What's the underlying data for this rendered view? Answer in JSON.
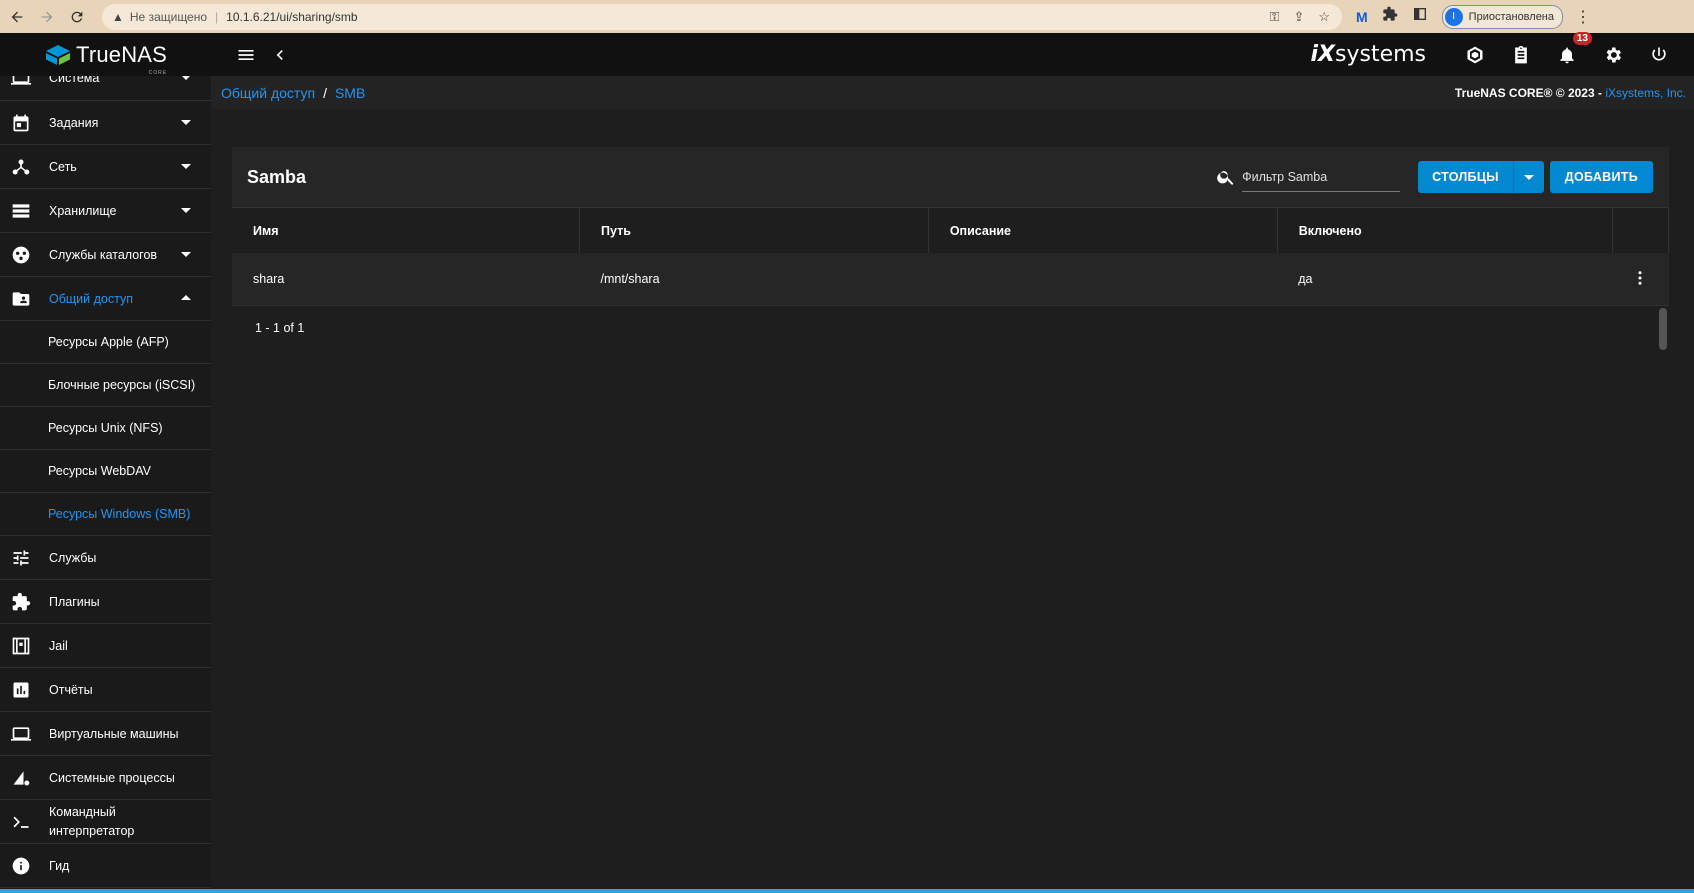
{
  "browser": {
    "security_label": "Не защищено",
    "url": "10.1.6.21/ui/sharing/smb",
    "profile_initial": "I",
    "profile_status": "Приостановлена"
  },
  "topbar": {
    "brand": "TrueNAS",
    "brand_sub": "CORE",
    "vendor_logo": "systems",
    "vendor_logo_prefix": "iX",
    "alerts_count": "13"
  },
  "breadcrumb": {
    "parent": "Общий доступ",
    "separator": "/",
    "current": "SMB"
  },
  "copyright": {
    "text": "TrueNAS CORE® © 2023 - ",
    "link": "iXsystems, Inc."
  },
  "sidebar": {
    "items": [
      {
        "label": "Система",
        "icon": "laptop-icon"
      },
      {
        "label": "Задания",
        "icon": "calendar-icon"
      },
      {
        "label": "Сеть",
        "icon": "network-icon"
      },
      {
        "label": "Хранилище",
        "icon": "storage-icon"
      },
      {
        "label": "Службы каталогов",
        "icon": "directory-icon"
      },
      {
        "label": "Общий доступ",
        "icon": "folder-shared-icon"
      }
    ],
    "sub_items": [
      {
        "label": "Ресурсы Apple (AFP)"
      },
      {
        "label": "Блочные ресурсы (iSCSI)"
      },
      {
        "label": "Ресурсы Unix (NFS)"
      },
      {
        "label": "Ресурсы WebDAV"
      },
      {
        "label": "Ресурсы Windows (SMB)"
      }
    ],
    "items_after": [
      {
        "label": "Службы",
        "icon": "tune-icon"
      },
      {
        "label": "Плагины",
        "icon": "puzzle-icon"
      },
      {
        "label": "Jail",
        "icon": "jail-icon"
      },
      {
        "label": "Отчёты",
        "icon": "chart-icon"
      },
      {
        "label": "Виртуальные машины",
        "icon": "vm-icon"
      },
      {
        "label": "Системные процессы",
        "icon": "processes-icon"
      },
      {
        "label": "Командный интерпретатор",
        "icon": "terminal-icon"
      },
      {
        "label": "Гид",
        "icon": "info-icon"
      }
    ]
  },
  "card": {
    "title": "Samba",
    "filter_placeholder": "Фильтр Samba",
    "columns_button": "СТОЛБЦЫ",
    "add_button": "ДОБАВИТЬ",
    "headers": [
      "Имя",
      "Путь",
      "Описание",
      "Включено"
    ],
    "rows": [
      {
        "name": "shara",
        "path": "/mnt/shara",
        "description": "",
        "enabled": "да"
      }
    ],
    "pagination": "1 - 1 of 1"
  },
  "colors": {
    "accent": "#2196f3",
    "button": "#0288d1",
    "badge": "#c62828"
  }
}
